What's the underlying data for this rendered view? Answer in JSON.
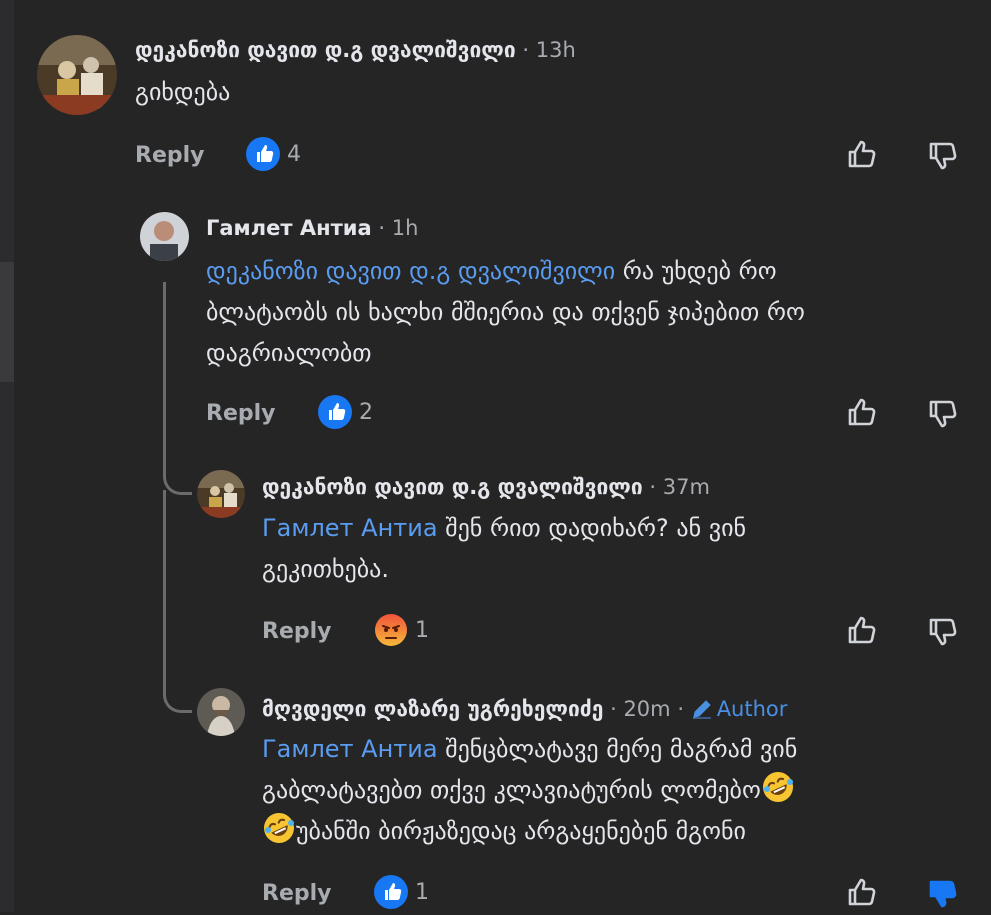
{
  "comments": [
    {
      "name": "დეკანოზი დავით დ.გ დვალიშვილი",
      "time": "13h",
      "text": "გიხდება",
      "reply_label": "Reply",
      "reaction": "like",
      "count": "4"
    },
    {
      "name": "Гамлет Антиа",
      "time": "1h",
      "mention": "დეკანოზი დავით დ.გ დვალიშვილი",
      "text_line1": " რა უხდებ  რო",
      "text_line2": "ბლატაობს  ის ხალხი მშიერია და თქვენ ჯიპებით რო",
      "text_line3": "დაგრიალობთ",
      "reply_label": "Reply",
      "reaction": "like",
      "count": "2"
    },
    {
      "name": "დეკანოზი დავით დ.გ დვალიშვილი",
      "time": "37m",
      "mention": "Гамлет Антиа",
      "text_line1": " შენ რით დადიხარ? ან ვინ",
      "text_line2": "გეკითხება.",
      "reply_label": "Reply",
      "reaction": "angry",
      "count": "1"
    },
    {
      "name": "მღვდელი ლაზარე უგრეხელიძე",
      "time": "20m",
      "author_badge": "Author",
      "mention": "Гамлет Антиа",
      "text_line1": " შენცბლატავე მერე მაგრამ ვინ",
      "text_line2": "გაბლატავებთ თქვე კლავიატურის ლომებო",
      "text_line3": "უბანში ბირჟაზედაც არგაყენებენ მგონი",
      "emojis": [
        "rofl-emoji",
        "rofl-emoji"
      ],
      "reply_label": "Reply",
      "reaction": "like",
      "count": "1",
      "disliked": true
    }
  ],
  "separator": "·",
  "colors": {
    "background": "#252526",
    "mention": "#5a9cf0",
    "like_blue": "#1877f2",
    "muted": "#a8abb0"
  }
}
